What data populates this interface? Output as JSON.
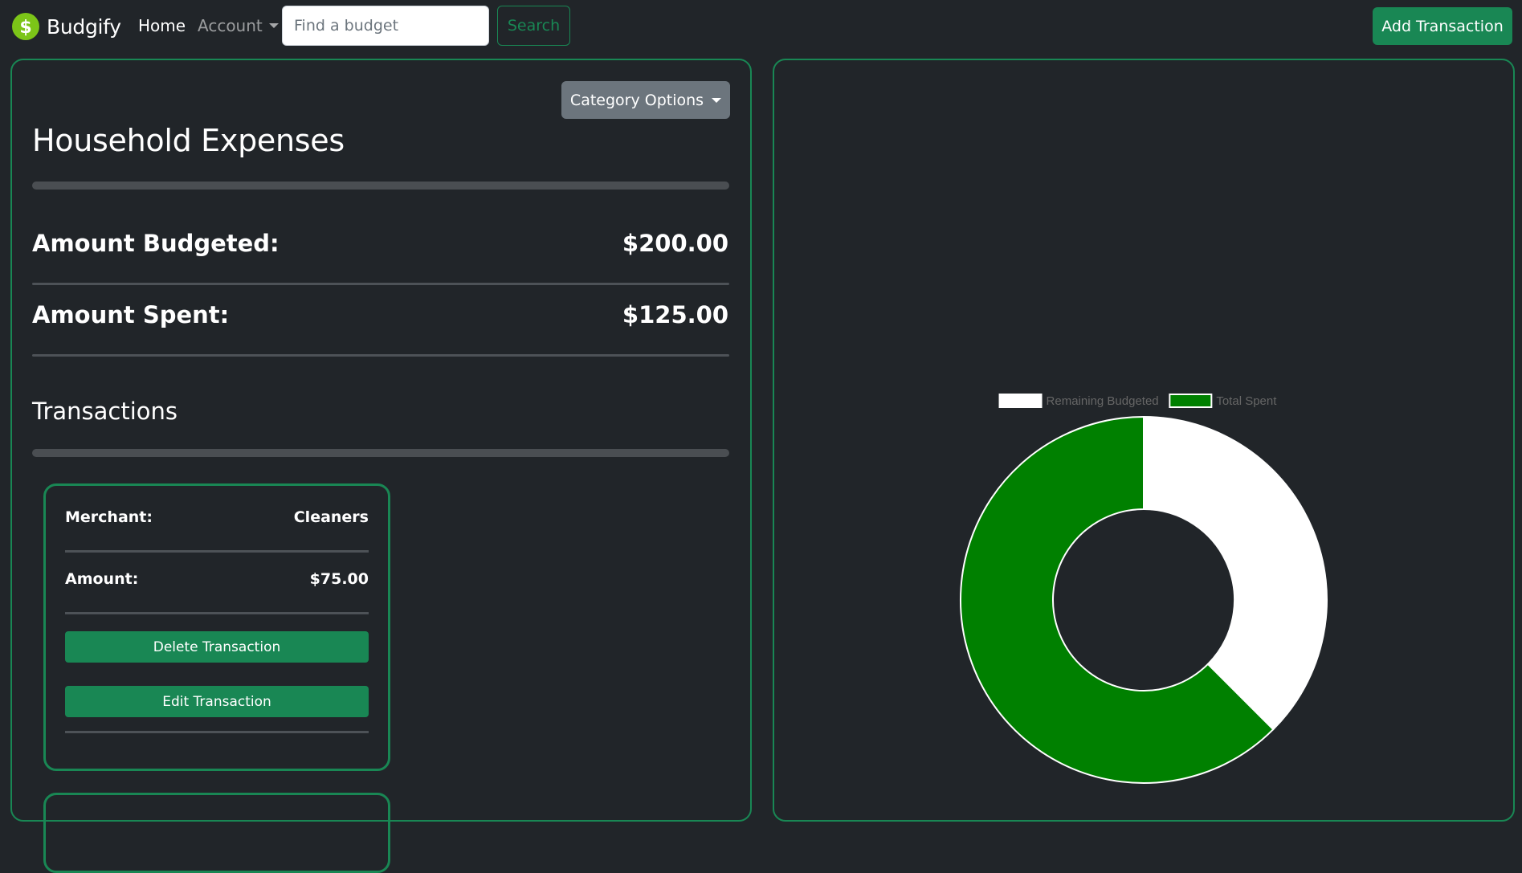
{
  "navbar": {
    "brand_name": "Budgify",
    "home_label": "Home",
    "account_label": "Account",
    "search_placeholder": "Find a budget",
    "search_label": "Search",
    "add_transaction_label": "Add Transaction",
    "brand_icon": "dollar-icon",
    "brand_color": "#7cc518"
  },
  "budget": {
    "category_options_label": "Category Options",
    "title": "Household Expenses",
    "budgeted_label": "Amount Budgeted:",
    "budgeted_value": "$200.00",
    "spent_label": "Amount Spent:",
    "spent_value": "$125.00",
    "transactions_title": "Transactions"
  },
  "transactions": [
    {
      "merchant_label": "Merchant:",
      "merchant": "Cleaners",
      "amount_label": "Amount:",
      "amount": "$75.00",
      "delete_label": "Delete Transaction",
      "edit_label": "Edit Transaction"
    }
  ],
  "colors": {
    "accent": "#198754",
    "background": "#212529",
    "secondary": "#6c757d",
    "chart_spent": "#008000",
    "chart_remaining": "#ffffff"
  },
  "chart_data": {
    "type": "pie",
    "variant": "doughnut",
    "categories": [
      "Remaining Budgeted",
      "Total Spent"
    ],
    "values": [
      75,
      125
    ],
    "colors": [
      "#ffffff",
      "#008000"
    ],
    "legend_position": "top"
  }
}
